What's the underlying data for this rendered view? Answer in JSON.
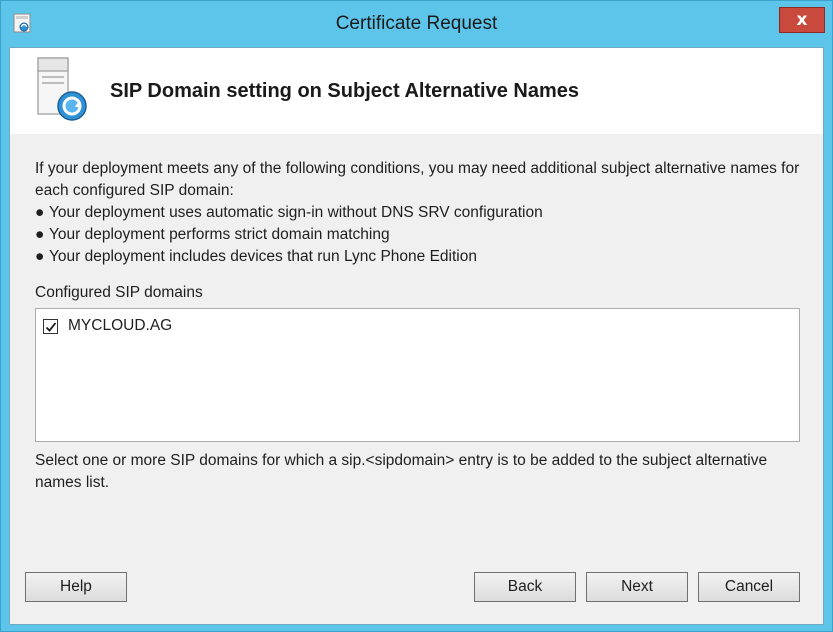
{
  "window": {
    "title": "Certificate Request",
    "close_label": "x"
  },
  "header": {
    "title": "SIP Domain setting on Subject Alternative Names"
  },
  "content": {
    "intro": "If your deployment meets any of the following conditions, you may need additional subject alternative names for each configured SIP domain:",
    "bullets": [
      "Your deployment uses automatic sign-in without DNS SRV configuration",
      "Your deployment performs strict domain matching",
      "Your deployment includes devices that run Lync Phone Edition"
    ],
    "bullet_char": "●"
  },
  "domains": {
    "label": "Configured SIP domains",
    "items": [
      {
        "name": "MYCLOUD.AG",
        "checked": true
      }
    ]
  },
  "hint": "Select one or more SIP domains for which a sip.<sipdomain> entry is to be added to the subject alternative names list.",
  "buttons": {
    "help": "Help",
    "back": "Back",
    "next": "Next",
    "cancel": "Cancel"
  },
  "colors": {
    "title_bar": "#5ec5ea",
    "close_button": "#c9493d",
    "client_bg": "#f0f0f0"
  }
}
